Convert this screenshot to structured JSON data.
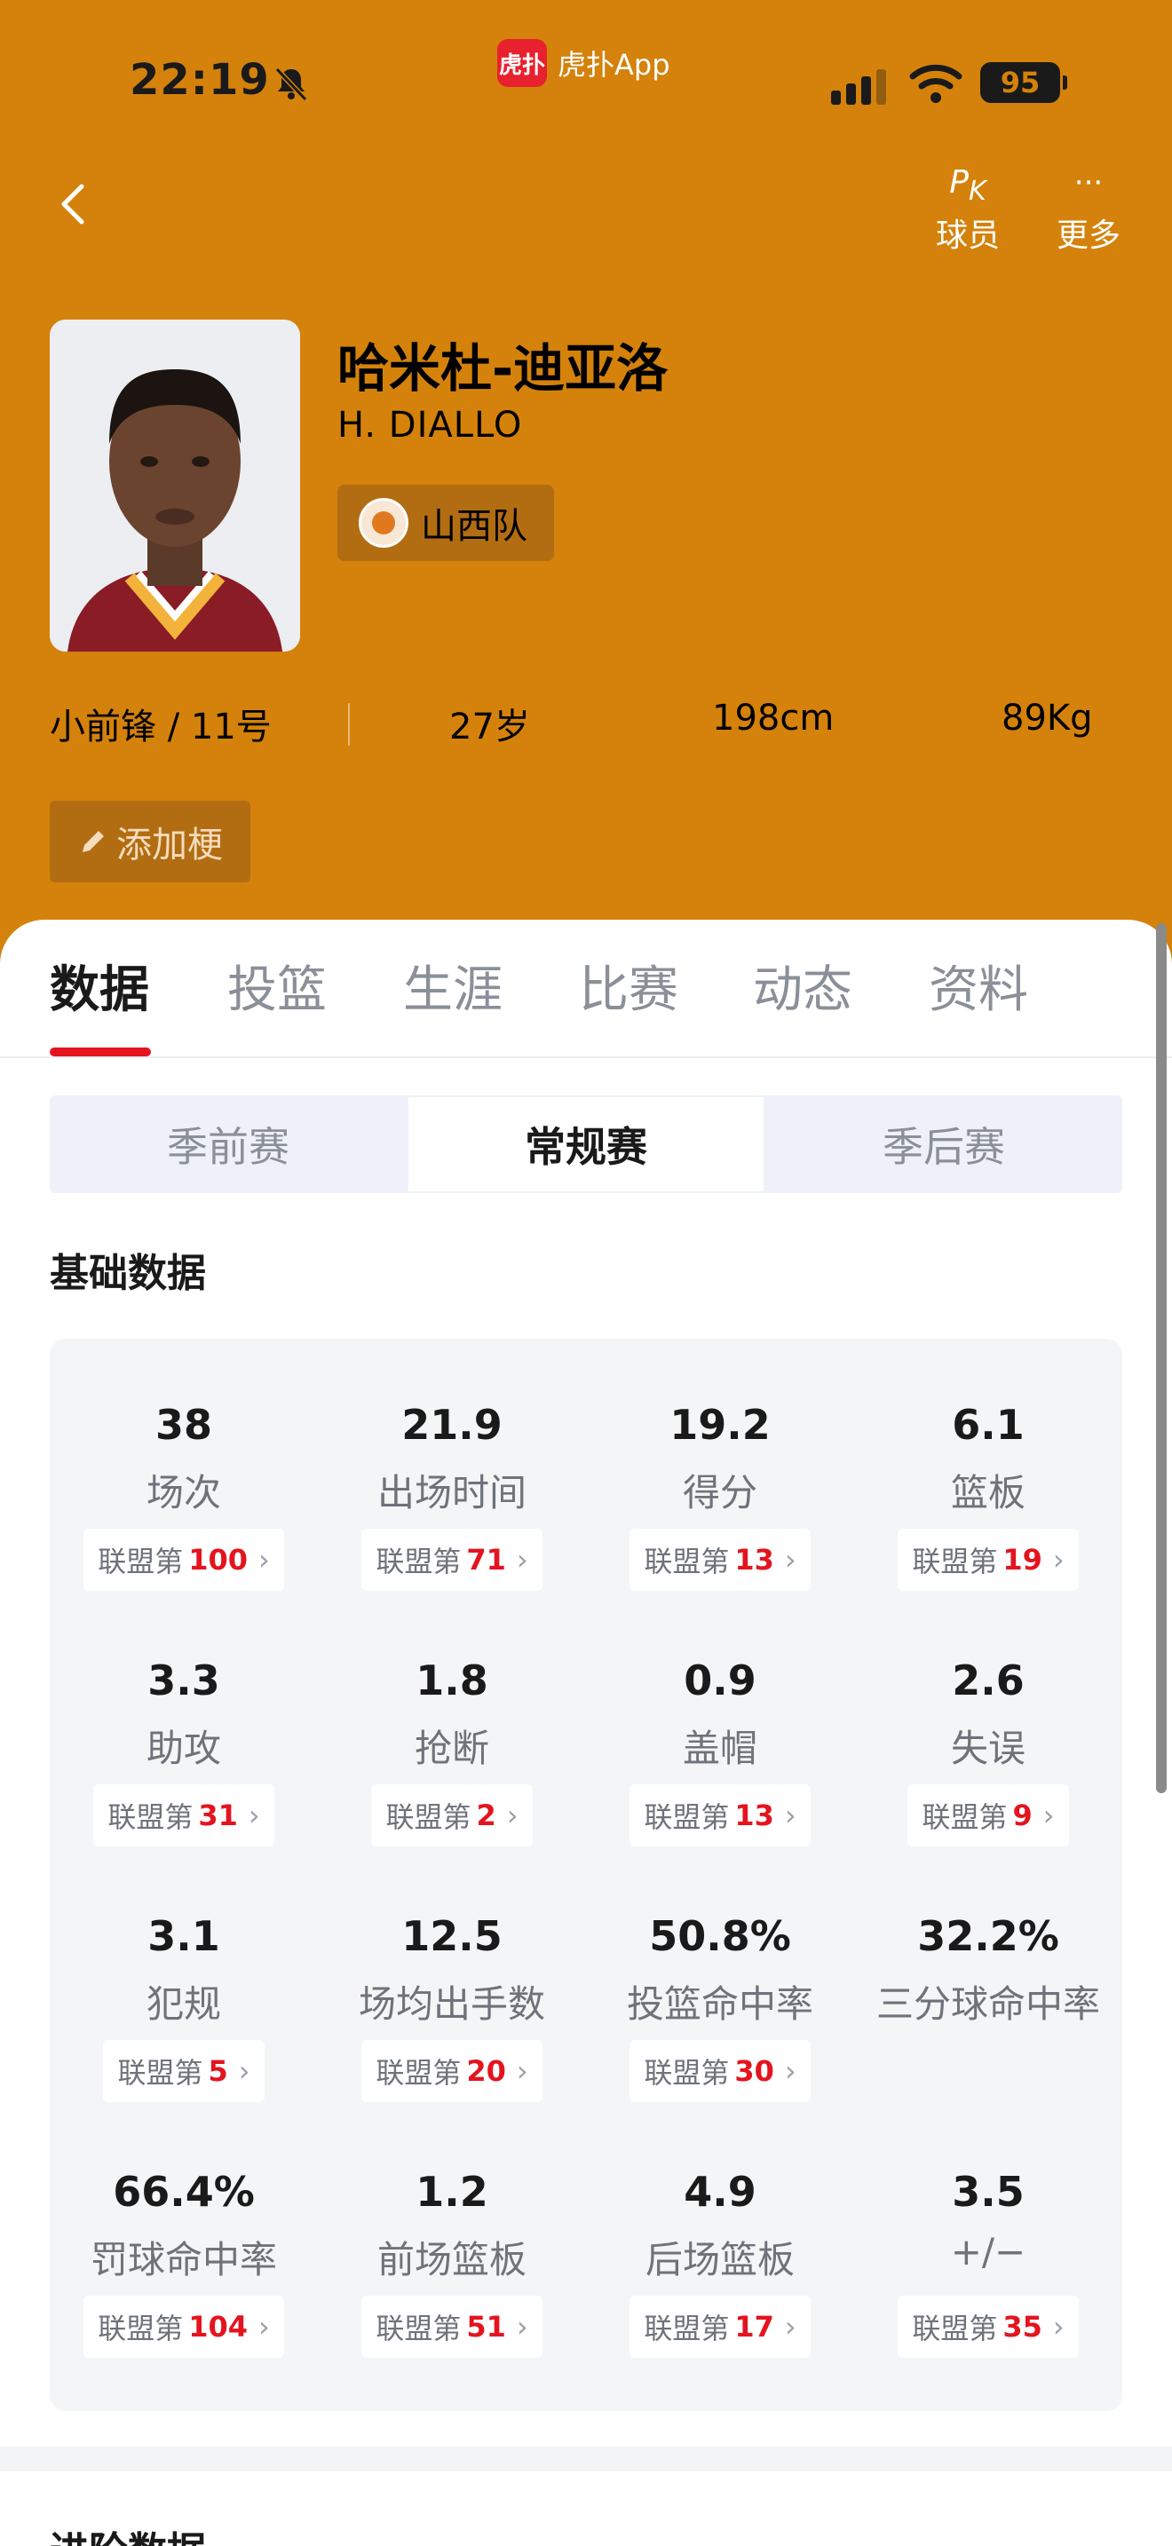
{
  "status_bar": {
    "time": "22:19",
    "battery": "95"
  },
  "app_badge": {
    "logo_text": "虎扑",
    "name": "虎扑App"
  },
  "nav": {
    "pk_label": "球员",
    "more_label": "更多"
  },
  "player": {
    "name_cn": "哈米杜-迪亚洛",
    "name_en": "H. DIALLO",
    "team": "山西队",
    "position_number": "小前锋 / 11号",
    "age": "27岁",
    "height": "198cm",
    "weight": "89Kg"
  },
  "add_tag_label": "添加梗",
  "tabs": [
    "数据",
    "投篮",
    "生涯",
    "比赛",
    "动态",
    "资料"
  ],
  "season_toggle": [
    "季前赛",
    "常规赛",
    "季后赛"
  ],
  "section_basic": "基础数据",
  "rank_prefix": "联盟第",
  "stats": [
    {
      "value": "38",
      "label": "场次",
      "rank": "100"
    },
    {
      "value": "21.9",
      "label": "出场时间",
      "rank": "71"
    },
    {
      "value": "19.2",
      "label": "得分",
      "rank": "13"
    },
    {
      "value": "6.1",
      "label": "篮板",
      "rank": "19"
    },
    {
      "value": "3.3",
      "label": "助攻",
      "rank": "31"
    },
    {
      "value": "1.8",
      "label": "抢断",
      "rank": "2"
    },
    {
      "value": "0.9",
      "label": "盖帽",
      "rank": "13"
    },
    {
      "value": "2.6",
      "label": "失误",
      "rank": "9"
    },
    {
      "value": "3.1",
      "label": "犯规",
      "rank": "5"
    },
    {
      "value": "12.5",
      "label": "场均出手数",
      "rank": "20"
    },
    {
      "value": "50.8%",
      "label": "投篮命中率",
      "rank": "30"
    },
    {
      "value": "32.2%",
      "label": "三分球命中率",
      "rank": null
    },
    {
      "value": "66.4%",
      "label": "罚球命中率",
      "rank": "104"
    },
    {
      "value": "1.2",
      "label": "前场篮板",
      "rank": "51"
    },
    {
      "value": "4.9",
      "label": "后场篮板",
      "rank": "17"
    },
    {
      "value": "3.5",
      "label": "+/−",
      "rank": "35"
    }
  ],
  "section_advanced": "进阶数据"
}
